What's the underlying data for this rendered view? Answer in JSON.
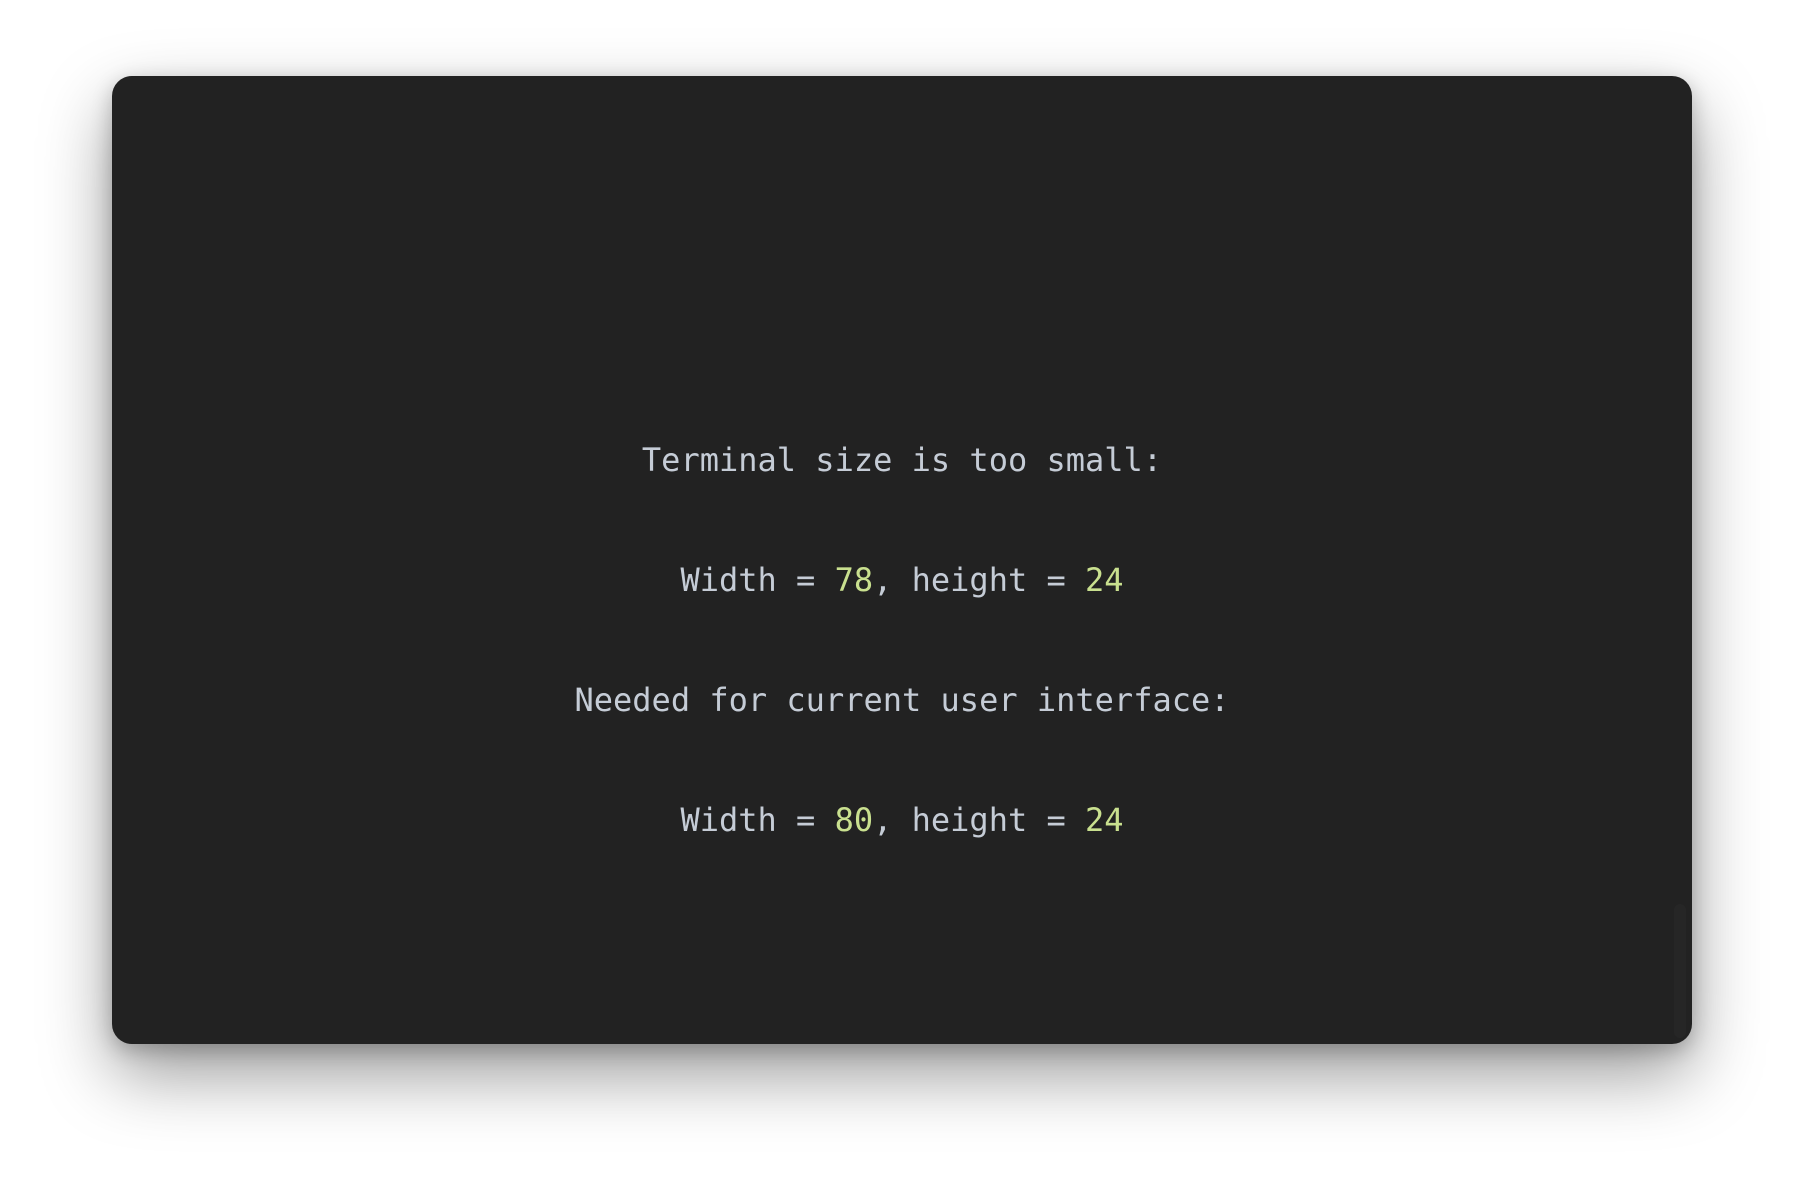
{
  "terminal": {
    "lines": [
      {
        "text": "Terminal size is too small:"
      },
      {
        "prefix": "Width = ",
        "width": "78",
        "middle": ", height = ",
        "height": "24"
      },
      {
        "text": "Needed for current user interface:"
      },
      {
        "prefix": "Width = ",
        "width": "80",
        "middle": ", height = ",
        "height": "24"
      }
    ],
    "colors": {
      "background": "#222222",
      "text": "#c5ccd6",
      "number": "#c9e08f"
    }
  }
}
